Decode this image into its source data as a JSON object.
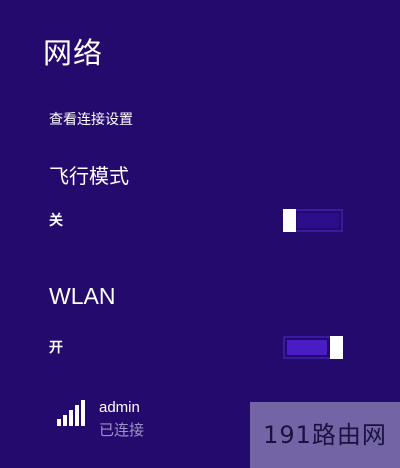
{
  "panel": {
    "title": "网络",
    "connection_settings_link": "查看连接设置"
  },
  "airplane_mode": {
    "label": "飞行模式",
    "state_label": "关",
    "on": false
  },
  "wlan": {
    "label": "WLAN",
    "state_label": "开",
    "on": true
  },
  "networks": [
    {
      "name": "admin",
      "status": "已连接",
      "icon": "wifi-signal-icon",
      "signal_bars": 5
    }
  ],
  "watermark": {
    "text": "191路由网"
  },
  "colors": {
    "background": "#250a6e",
    "toggle_on": "#4a1cc6",
    "toggle_off": "#2c0d8a",
    "status_text": "#9a93c6"
  }
}
